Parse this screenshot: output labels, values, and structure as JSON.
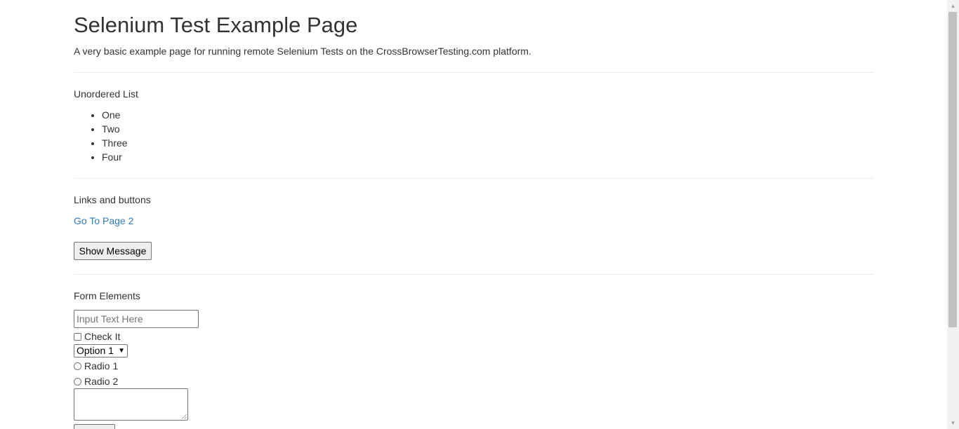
{
  "header": {
    "title": "Selenium Test Example Page",
    "subtitle": "A very basic example page for running remote Selenium Tests on the CrossBrowserTesting.com platform."
  },
  "list_section": {
    "heading": "Unordered List",
    "items": [
      "One",
      "Two",
      "Three",
      "Four"
    ]
  },
  "links_section": {
    "heading": "Links and buttons",
    "link_text": "Go To Page 2",
    "button_label": "Show Message"
  },
  "form_section": {
    "heading": "Form Elements",
    "text_input": {
      "placeholder": "Input Text Here",
      "value": ""
    },
    "checkbox_label": "Check It",
    "select_value": "Option 1",
    "radio_1_label": "Radio 1",
    "radio_2_label": "Radio 2"
  },
  "colors": {
    "link": "#337ab7",
    "text": "#333333",
    "divider": "#eeeeee"
  }
}
